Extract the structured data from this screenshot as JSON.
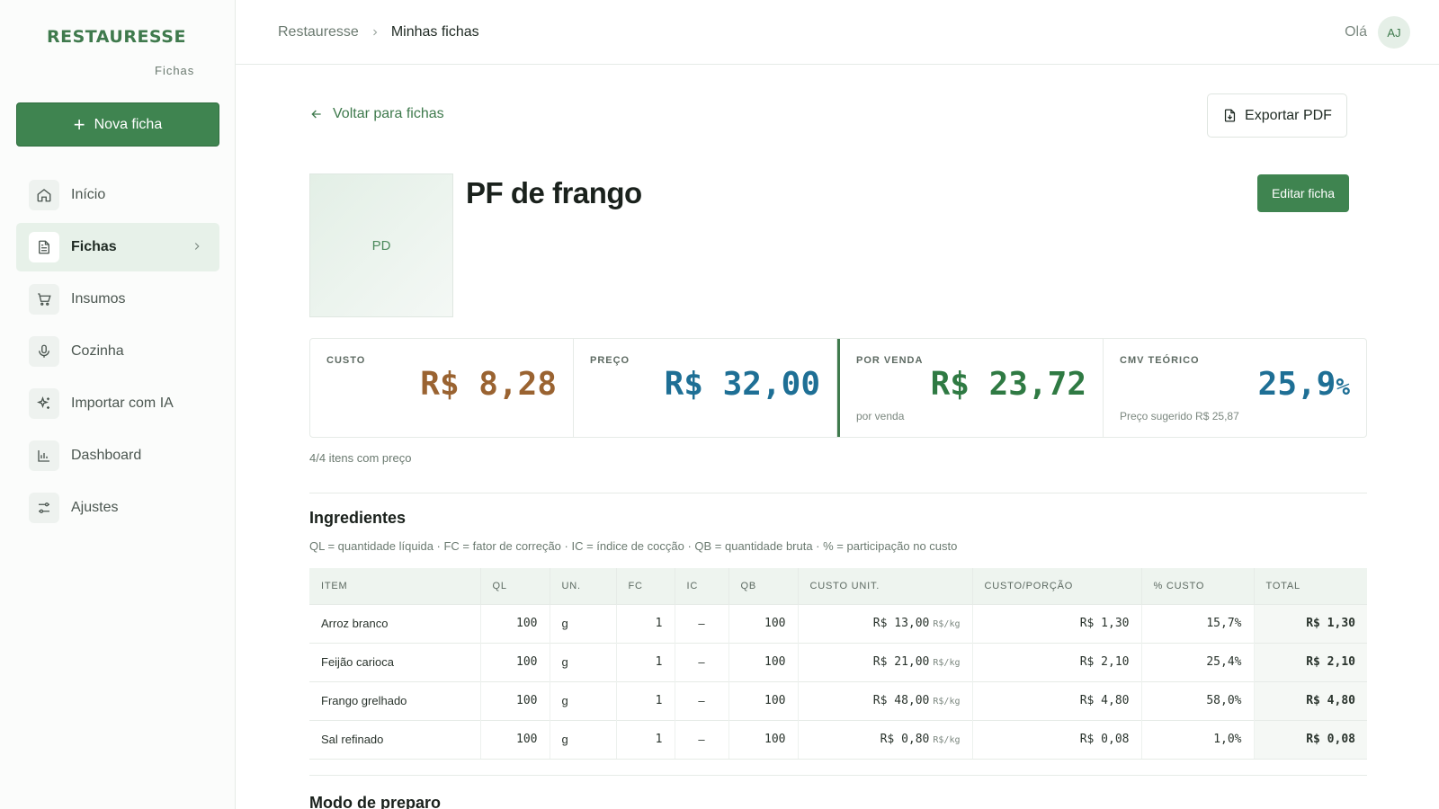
{
  "brand": {
    "name": "RESTAURESSE",
    "sub": "Fichas"
  },
  "sidebar": {
    "new_label": "Nova ficha",
    "items": [
      {
        "label": "Início",
        "icon": "home-icon"
      },
      {
        "label": "Fichas",
        "icon": "document-icon",
        "active": true
      },
      {
        "label": "Insumos",
        "icon": "cart-icon"
      },
      {
        "label": "Cozinha",
        "icon": "microphone-icon"
      },
      {
        "label": "Importar com IA",
        "icon": "sparkle-icon"
      },
      {
        "label": "Dashboard",
        "icon": "bar-chart-icon"
      },
      {
        "label": "Ajustes",
        "icon": "sliders-icon"
      }
    ]
  },
  "header": {
    "breadcrumb_root": "Restauresse",
    "breadcrumb_current": "Minhas fichas",
    "greeting": "Olá",
    "avatar": "AJ"
  },
  "page": {
    "back_label": "Voltar para fichas",
    "export_label": "Exportar PDF",
    "thumb_initials": "PD",
    "title": "PF de frango",
    "edit_label": "Editar ficha"
  },
  "stats": {
    "cost": {
      "label": "CUSTO",
      "value": "R$ 8,28"
    },
    "price": {
      "label": "PREÇO",
      "value": "R$ 32,00"
    },
    "sale": {
      "label": "POR VENDA",
      "value": "R$ 23,72",
      "sub": "por venda"
    },
    "cmv": {
      "label": "CMV TEÓRICO",
      "value": "25,9",
      "suffix": "%",
      "sub": "Preço sugerido R$ 25,87"
    }
  },
  "items_note": "4/4 itens com preço",
  "ingredients": {
    "title": "Ingredientes",
    "legend": "QL = quantidade líquida · FC = fator de correção · IC = índice de cocção · QB = quantidade bruta · % = participação no custo",
    "columns": [
      "ITEM",
      "QL",
      "UN.",
      "FC",
      "IC",
      "QB",
      "CUSTO UNIT.",
      "CUSTO/PORÇÃO",
      "% CUSTO",
      "TOTAL"
    ],
    "rows": [
      {
        "item": "Arroz branco",
        "ql": "100",
        "un": "g",
        "fc": "1",
        "ic": "–",
        "qb": "100",
        "unit_cost": "R$ 13,00",
        "unit_suffix": "R$/kg",
        "portion": "R$ 1,30",
        "pct": "15,7%",
        "total": "R$ 1,30"
      },
      {
        "item": "Feijão carioca",
        "ql": "100",
        "un": "g",
        "fc": "1",
        "ic": "–",
        "qb": "100",
        "unit_cost": "R$ 21,00",
        "unit_suffix": "R$/kg",
        "portion": "R$ 2,10",
        "pct": "25,4%",
        "total": "R$ 2,10"
      },
      {
        "item": "Frango grelhado",
        "ql": "100",
        "un": "g",
        "fc": "1",
        "ic": "–",
        "qb": "100",
        "unit_cost": "R$ 48,00",
        "unit_suffix": "R$/kg",
        "portion": "R$ 4,80",
        "pct": "58,0%",
        "total": "R$ 4,80"
      },
      {
        "item": "Sal refinado",
        "ql": "100",
        "un": "g",
        "fc": "1",
        "ic": "–",
        "qb": "100",
        "unit_cost": "R$ 0,80",
        "unit_suffix": "R$/kg",
        "portion": "R$ 0,08",
        "pct": "1,0%",
        "total": "R$ 0,08"
      }
    ]
  },
  "preparation": {
    "title": "Modo de preparo"
  },
  "colors": {
    "accent": "#3f8450",
    "cost": "#9a6331",
    "price": "#1e6f95",
    "sale": "#2f7a43"
  }
}
